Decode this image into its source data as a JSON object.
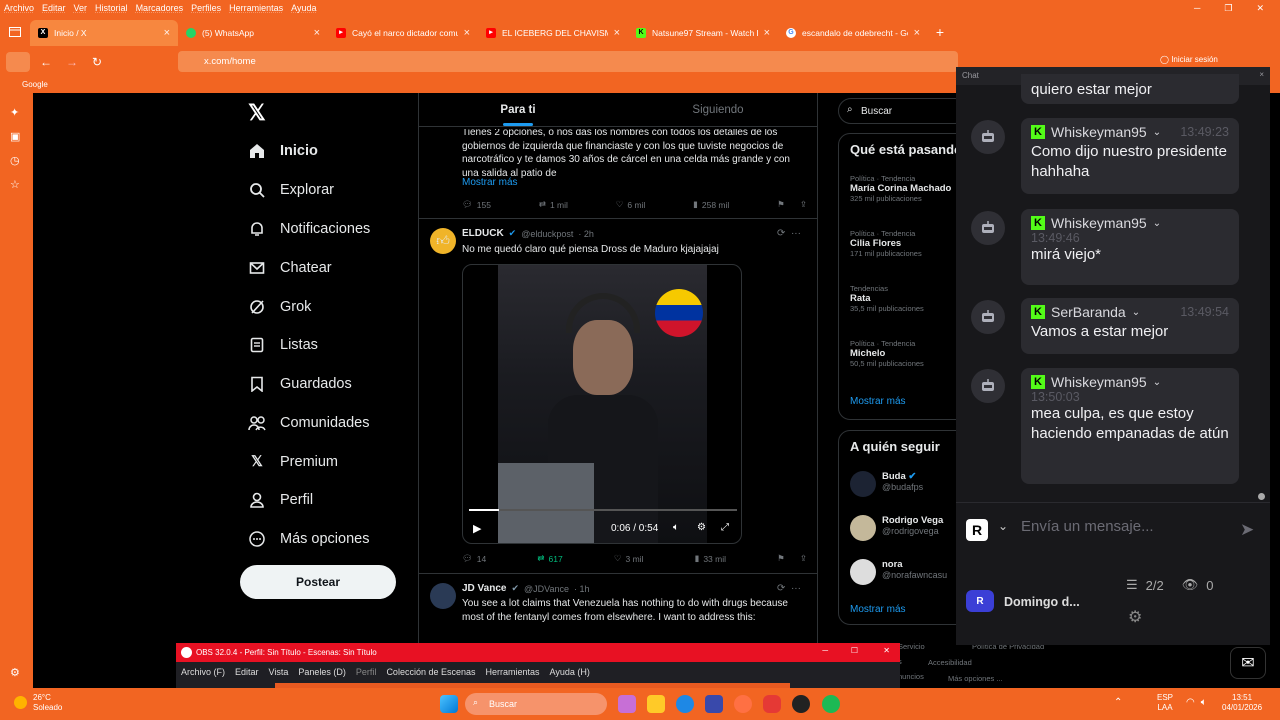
{
  "browser": {
    "menu": [
      "Archivo",
      "Editar",
      "Ver",
      "Historial",
      "Marcadores",
      "Perfiles",
      "Herramientas",
      "Ayuda"
    ],
    "tabs": [
      {
        "title": "Inicio / X",
        "favicon": "X",
        "color": "#000000"
      },
      {
        "title": "(5) WhatsApp",
        "favicon": "W",
        "color": "#25d366"
      },
      {
        "title": "Cayó el narco dictador comunis",
        "favicon": "▶",
        "color": "#ff0000"
      },
      {
        "title": "EL ICEBERG DEL CHAVISMO: De",
        "favicon": "▶",
        "color": "#ff0000"
      },
      {
        "title": "Natsune97 Stream - Watch Live",
        "favicon": "K",
        "color": "#53fc18"
      },
      {
        "title": "escandalo de odebrecht - Goog",
        "favicon": "G",
        "color": "#4285f4"
      }
    ],
    "url": "x.com/home",
    "bookmark": "Google",
    "signin": "Iniciar sesión"
  },
  "twitter": {
    "nav": [
      "Inicio",
      "Explorar",
      "Notificaciones",
      "Chatear",
      "Grok",
      "Listas",
      "Guardados",
      "Comunidades",
      "Premium",
      "Perfil",
      "Más opciones"
    ],
    "post_button": "Postear",
    "tabs": [
      "Para ti",
      "Siguiendo"
    ],
    "tweet1": {
      "text": "Tienes 2 opciones, o nos das los nombres con todos los detalles de los gobiernos de izquierda que financiaste y con los que tuviste negocios de narcotráfico y te damos 30 años de cárcel en una celda más grande y con una salida al patio de",
      "more": "Mostrar más",
      "replies": "155",
      "reposts": "1 mil",
      "likes": "6 mil",
      "views": "258 mil"
    },
    "tweet2": {
      "name": "ELDUCK",
      "handle": "@elduckpost",
      "time": "· 2h",
      "text": "No me quedó claro qué piensa Dross de Maduro kjajajajaj",
      "video_time": "0:06 / 0:54",
      "replies": "14",
      "reposts": "617",
      "likes": "3 mil",
      "views": "33 mil"
    },
    "tweet3": {
      "name": "JD Vance",
      "handle": "@JDVance",
      "time": "· 1h",
      "text": "You see a lot claims that Venezuela has nothing to do with drugs because most of the fentanyl comes from elsewhere. I want to address this:"
    },
    "search_placeholder": "Buscar",
    "trends_title": "Qué está pasando",
    "trends": [
      {
        "cat": "Política · Tendencia",
        "name": "María Corina Machado",
        "count": "325 mil publicaciones"
      },
      {
        "cat": "Política · Tendencia",
        "name": "Cilia Flores",
        "count": "171 mil publicaciones"
      },
      {
        "cat": "Tendencias",
        "name": "Rata",
        "count": "35,5 mil publicaciones"
      },
      {
        "cat": "Política · Tendencia",
        "name": "Michelo",
        "count": "50,5 mil publicaciones"
      }
    ],
    "show_more": "Mostrar más",
    "follow_title": "A quién seguir",
    "follow": [
      {
        "name": "Buda",
        "handle": "@budafps"
      },
      {
        "name": "Rodrigo Vega",
        "handle": "@rodrigovega"
      },
      {
        "name": "nora",
        "handle": "@norafawncasu"
      }
    ],
    "footer_links": [
      "Servicio",
      "Política de Privacidad",
      "s",
      "Accesibilidad",
      "nuncios",
      "Más opciones ..."
    ]
  },
  "chat": {
    "header": "Chat",
    "close": "×",
    "messages": [
      {
        "user": "",
        "time": "",
        "text": "quiero estar mejor"
      },
      {
        "user": "Whiskeyman95",
        "time": "13:49:23",
        "text": "Como dijo nuestro presidente hahhaha"
      },
      {
        "user": "Whiskeyman95",
        "time": "13:49:46",
        "text": "mirá viejo*"
      },
      {
        "user": "SerBaranda",
        "time": "13:49:54",
        "text": "Vamos a estar mejor"
      },
      {
        "user": "Whiskeyman95",
        "time": "13:50:03",
        "text": "mea culpa, es que estoy haciendo empanadas de atún"
      }
    ],
    "input_placeholder": "Envía un mensaje...",
    "channel": "Domingo d...",
    "viewers_ratio": "2/2",
    "eye_count": "0"
  },
  "obs": {
    "title": "OBS 32.0.4 - Perfil: Sin Título - Escenas: Sin Título",
    "menu": [
      "Archivo (F)",
      "Editar",
      "Vista",
      "Paneles (D)",
      "Perfil",
      "Colección de Escenas",
      "Herramientas",
      "Ayuda (H)"
    ]
  },
  "taskbar": {
    "temp": "26°C",
    "weather": "Soleado",
    "search": "Buscar",
    "lang1": "ESP",
    "lang2": "LAA",
    "time": "13:51",
    "date": "04/01/2026"
  }
}
